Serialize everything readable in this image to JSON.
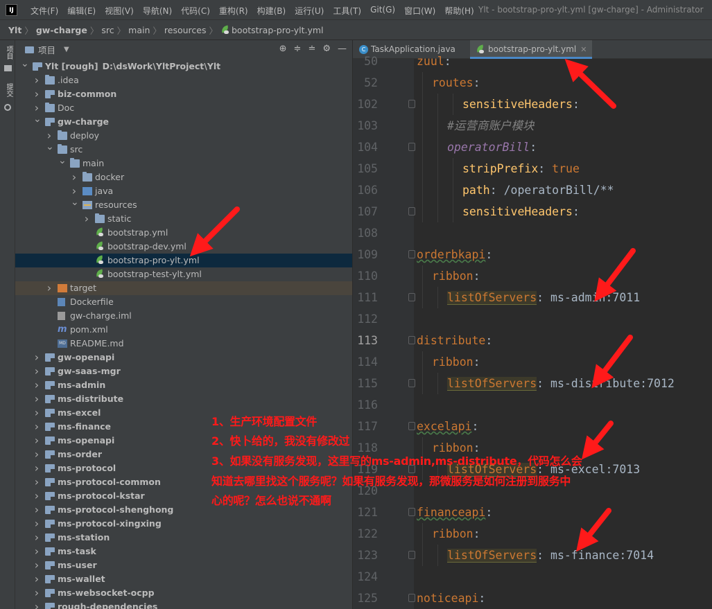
{
  "window": {
    "logo": "IJ",
    "menu": [
      "文件(F)",
      "编辑(E)",
      "视图(V)",
      "导航(N)",
      "代码(C)",
      "重构(R)",
      "构建(B)",
      "运行(U)",
      "工具(T)",
      "Git(G)",
      "窗口(W)",
      "帮助(H)"
    ],
    "title": "Ylt - bootstrap-pro-ylt.yml [gw-charge] - Administrator"
  },
  "breadcrumb": [
    "Ylt",
    "gw-charge",
    "src",
    "main",
    "resources",
    "bootstrap-pro-ylt.yml"
  ],
  "left_stripe": {
    "project": "项目",
    "commit": "提交"
  },
  "project_pane": {
    "title": "项目",
    "tree": [
      {
        "label": "Ylt [rough]",
        "extra": "D:\\dsWork\\YltProject\\Ylt",
        "depth": 0,
        "expanded": true,
        "icon": "module",
        "bold": true
      },
      {
        "label": ".idea",
        "depth": 1,
        "expanded": false,
        "icon": "folder"
      },
      {
        "label": "biz-common",
        "depth": 1,
        "expanded": false,
        "icon": "module",
        "bold": true
      },
      {
        "label": "Doc",
        "depth": 1,
        "expanded": false,
        "icon": "folder"
      },
      {
        "label": "gw-charge",
        "depth": 1,
        "expanded": true,
        "icon": "module",
        "bold": true
      },
      {
        "label": "deploy",
        "depth": 2,
        "expanded": false,
        "icon": "folder"
      },
      {
        "label": "src",
        "depth": 2,
        "expanded": true,
        "icon": "folder"
      },
      {
        "label": "main",
        "depth": 3,
        "expanded": true,
        "icon": "folder"
      },
      {
        "label": "docker",
        "depth": 4,
        "expanded": false,
        "icon": "folder"
      },
      {
        "label": "java",
        "depth": 4,
        "expanded": false,
        "icon": "src"
      },
      {
        "label": "resources",
        "depth": 4,
        "expanded": true,
        "icon": "res"
      },
      {
        "label": "static",
        "depth": 5,
        "expanded": false,
        "icon": "folder"
      },
      {
        "label": "bootstrap.yml",
        "depth": 5,
        "icon": "yml"
      },
      {
        "label": "bootstrap-dev.yml",
        "depth": 5,
        "icon": "yml"
      },
      {
        "label": "bootstrap-pro-ylt.yml",
        "depth": 5,
        "icon": "yml",
        "selected": true
      },
      {
        "label": "bootstrap-test-ylt.yml",
        "depth": 5,
        "icon": "yml"
      },
      {
        "label": "target",
        "depth": 2,
        "expanded": false,
        "icon": "target",
        "excluded": true
      },
      {
        "label": "Dockerfile",
        "depth": 2,
        "icon": "docker"
      },
      {
        "label": "gw-charge.iml",
        "depth": 2,
        "icon": "file"
      },
      {
        "label": "pom.xml",
        "depth": 2,
        "icon": "mvn"
      },
      {
        "label": "README.md",
        "depth": 2,
        "icon": "md"
      },
      {
        "label": "gw-openapi",
        "depth": 1,
        "expanded": false,
        "icon": "module",
        "bold": true
      },
      {
        "label": "gw-saas-mgr",
        "depth": 1,
        "expanded": false,
        "icon": "module",
        "bold": true
      },
      {
        "label": "ms-admin",
        "depth": 1,
        "expanded": false,
        "icon": "module",
        "bold": true
      },
      {
        "label": "ms-distribute",
        "depth": 1,
        "expanded": false,
        "icon": "module",
        "bold": true
      },
      {
        "label": "ms-excel",
        "depth": 1,
        "expanded": false,
        "icon": "module",
        "bold": true
      },
      {
        "label": "ms-finance",
        "depth": 1,
        "expanded": false,
        "icon": "module",
        "bold": true
      },
      {
        "label": "ms-openapi",
        "depth": 1,
        "expanded": false,
        "icon": "module",
        "bold": true
      },
      {
        "label": "ms-order",
        "depth": 1,
        "expanded": false,
        "icon": "module",
        "bold": true
      },
      {
        "label": "ms-protocol",
        "depth": 1,
        "expanded": false,
        "icon": "module",
        "bold": true
      },
      {
        "label": "ms-protocol-common",
        "depth": 1,
        "expanded": false,
        "icon": "module",
        "bold": true
      },
      {
        "label": "ms-protocol-kstar",
        "depth": 1,
        "expanded": false,
        "icon": "module",
        "bold": true
      },
      {
        "label": "ms-protocol-shenghong",
        "depth": 1,
        "expanded": false,
        "icon": "module",
        "bold": true
      },
      {
        "label": "ms-protocol-xingxing",
        "depth": 1,
        "expanded": false,
        "icon": "module",
        "bold": true
      },
      {
        "label": "ms-station",
        "depth": 1,
        "expanded": false,
        "icon": "module",
        "bold": true
      },
      {
        "label": "ms-task",
        "depth": 1,
        "expanded": false,
        "icon": "module",
        "bold": true
      },
      {
        "label": "ms-user",
        "depth": 1,
        "expanded": false,
        "icon": "module",
        "bold": true
      },
      {
        "label": "ms-wallet",
        "depth": 1,
        "expanded": false,
        "icon": "module",
        "bold": true
      },
      {
        "label": "ms-websocket-ocpp",
        "depth": 1,
        "expanded": false,
        "icon": "module",
        "bold": true
      },
      {
        "label": "rough-dependencies",
        "depth": 1,
        "expanded": false,
        "icon": "module",
        "bold": true
      }
    ]
  },
  "editor": {
    "tabs": [
      {
        "label": "TaskApplication.java",
        "icon": "java",
        "active": false
      },
      {
        "label": "bootstrap-pro-ylt.yml",
        "icon": "yml",
        "active": true
      }
    ],
    "lines": [
      {
        "n": "50",
        "indent": 0,
        "parts": [
          {
            "t": "zuul",
            "c": "k"
          },
          {
            "t": ":",
            "c": "v"
          }
        ]
      },
      {
        "n": "52",
        "indent": 1,
        "parts": [
          {
            "t": "routes",
            "c": "k"
          },
          {
            "t": ":",
            "c": "v"
          }
        ]
      },
      {
        "n": "102",
        "indent": 3,
        "fold": true,
        "parts": [
          {
            "t": "sensitiveHeaders",
            "c": "vp"
          },
          {
            "t": ":",
            "c": "v"
          }
        ]
      },
      {
        "n": "103",
        "indent": 2,
        "parts": [
          {
            "t": "#运营商账户模块",
            "c": "c"
          }
        ]
      },
      {
        "n": "104",
        "indent": 2,
        "fold": true,
        "parts": [
          {
            "t": "operatorBill",
            "c": "kp"
          },
          {
            "t": ":",
            "c": "v"
          }
        ]
      },
      {
        "n": "105",
        "indent": 3,
        "parts": [
          {
            "t": "stripPrefix",
            "c": "vp"
          },
          {
            "t": ": ",
            "c": "v"
          },
          {
            "t": "true",
            "c": "k"
          }
        ]
      },
      {
        "n": "106",
        "indent": 3,
        "parts": [
          {
            "t": "path",
            "c": "vp"
          },
          {
            "t": ": /operatorBill/**",
            "c": "v"
          }
        ]
      },
      {
        "n": "107",
        "indent": 3,
        "fold": true,
        "parts": [
          {
            "t": "sensitiveHeaders",
            "c": "vp"
          },
          {
            "t": ":",
            "c": "v"
          }
        ]
      },
      {
        "n": "108",
        "indent": 0,
        "parts": []
      },
      {
        "n": "109",
        "indent": 0,
        "fold": true,
        "parts": [
          {
            "t": "orderbkapi",
            "c": "k wavy"
          },
          {
            "t": ":",
            "c": "v"
          }
        ]
      },
      {
        "n": "110",
        "indent": 1,
        "parts": [
          {
            "t": "ribbon",
            "c": "k"
          },
          {
            "t": ":",
            "c": "v"
          }
        ]
      },
      {
        "n": "111",
        "indent": 2,
        "fold": true,
        "parts": [
          {
            "t": "listOfServers",
            "c": "kh"
          },
          {
            "t": ": ms-admin:7011",
            "c": "v"
          }
        ]
      },
      {
        "n": "112",
        "indent": 0,
        "parts": []
      },
      {
        "n": "113",
        "indent": 0,
        "fold": true,
        "cur": true,
        "parts": [
          {
            "t": "distribute",
            "c": "k"
          },
          {
            "t": ":",
            "c": "v"
          }
        ]
      },
      {
        "n": "114",
        "indent": 1,
        "parts": [
          {
            "t": "ribbon",
            "c": "k"
          },
          {
            "t": ":",
            "c": "v"
          }
        ]
      },
      {
        "n": "115",
        "indent": 2,
        "fold": true,
        "parts": [
          {
            "t": "listOfServers",
            "c": "kh"
          },
          {
            "t": ": ms-distribute:7012",
            "c": "v"
          }
        ]
      },
      {
        "n": "116",
        "indent": 0,
        "parts": []
      },
      {
        "n": "117",
        "indent": 0,
        "fold": true,
        "parts": [
          {
            "t": "excelapi",
            "c": "k wavy"
          },
          {
            "t": ":",
            "c": "v"
          }
        ]
      },
      {
        "n": "118",
        "indent": 1,
        "parts": [
          {
            "t": "ribbon",
            "c": "k"
          },
          {
            "t": ":",
            "c": "v"
          }
        ]
      },
      {
        "n": "119",
        "indent": 2,
        "fold": true,
        "parts": [
          {
            "t": "listOfServers",
            "c": "kh"
          },
          {
            "t": ": ms-excel:7013",
            "c": "v"
          }
        ]
      },
      {
        "n": "120",
        "indent": 0,
        "parts": []
      },
      {
        "n": "121",
        "indent": 0,
        "fold": true,
        "parts": [
          {
            "t": "financeapi",
            "c": "k wavy"
          },
          {
            "t": ":",
            "c": "v"
          }
        ]
      },
      {
        "n": "122",
        "indent": 1,
        "parts": [
          {
            "t": "ribbon",
            "c": "k"
          },
          {
            "t": ":",
            "c": "v"
          }
        ]
      },
      {
        "n": "123",
        "indent": 2,
        "fold": true,
        "parts": [
          {
            "t": "listOfServers",
            "c": "kh"
          },
          {
            "t": ": ms-finance:7014",
            "c": "v"
          }
        ]
      },
      {
        "n": "124",
        "indent": 0,
        "parts": []
      },
      {
        "n": "125",
        "indent": 0,
        "fold": true,
        "parts": [
          {
            "t": "noticeapi",
            "c": "k"
          },
          {
            "t": ":",
            "c": "v"
          }
        ]
      }
    ]
  },
  "annotation": {
    "lines": [
      "1、生产环境配置文件",
      "2、快卜给的，我没有修改过",
      "3、如果没有服务发现，这里写的ms-admin,ms-distribute，代码怎么会",
      "知道去哪里找这个服务呢？如果有服务发现，那微服务是如何注册到服务中",
      "心的呢？怎么也说不通啊"
    ],
    "color": "#ff1a1a"
  }
}
